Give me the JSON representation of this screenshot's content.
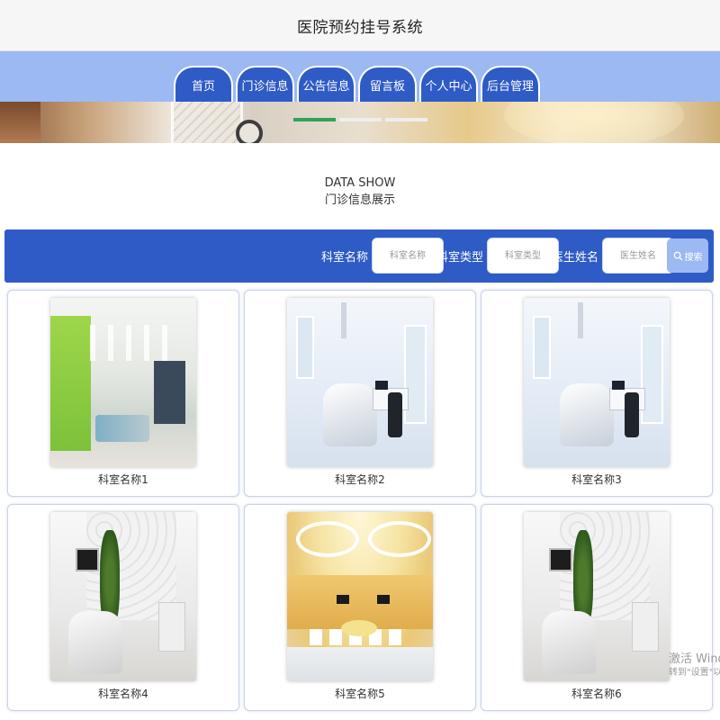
{
  "header": {
    "title": "医院预约挂号系统"
  },
  "nav": {
    "items": [
      {
        "label": "首页"
      },
      {
        "label": "门诊信息"
      },
      {
        "label": "公告信息"
      },
      {
        "label": "留言板"
      },
      {
        "label": "个人中心"
      },
      {
        "label": "后台管理"
      }
    ],
    "accent": "#2e5bc6",
    "bar_color": "#9db9f4"
  },
  "carousel": {
    "slide_count": 3,
    "active_index": 0,
    "active_color": "#2fa35a"
  },
  "section": {
    "title_en": "DATA SHOW",
    "title_cn": "门诊信息展示"
  },
  "search": {
    "fields": [
      {
        "label": "科室名称",
        "placeholder": "科室名称"
      },
      {
        "label": "科室类型",
        "placeholder": "科室类型"
      },
      {
        "label": "医生姓名",
        "placeholder": "医生姓名"
      }
    ],
    "button_label": "搜索",
    "button_icon": "search-icon"
  },
  "cards": [
    {
      "name": "科室名称1",
      "photo": "hospital-hallway-photo"
    },
    {
      "name": "科室名称2",
      "photo": "dental-clinic-photo"
    },
    {
      "name": "科室名称3",
      "photo": "dental-clinic-photo"
    },
    {
      "name": "科室名称4",
      "photo": "dental-office-photo"
    },
    {
      "name": "科室名称5",
      "photo": "waiting-lobby-photo"
    },
    {
      "name": "科室名称6",
      "photo": "dental-office-photo"
    }
  ],
  "watermark": {
    "line1": "激活 Wind",
    "line2": "转到\"设置\"以激"
  }
}
